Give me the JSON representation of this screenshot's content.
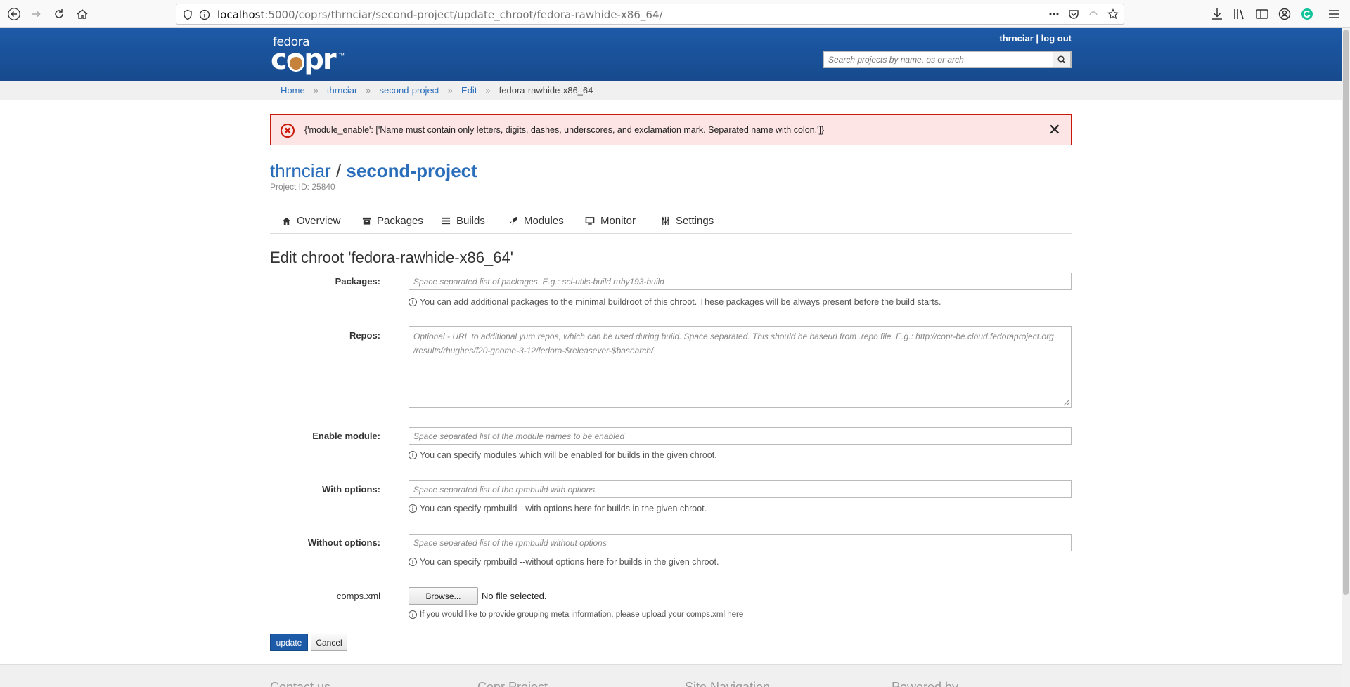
{
  "browser": {
    "url_host": "localhost",
    "url_rest": ":5000/coprs/thrnciar/second-project/update_chroot/fedora-rawhide-x86_64/"
  },
  "header": {
    "logo_top": "fedora",
    "logo_main": "copr",
    "user": "thrnciar",
    "separator": "|",
    "logout": "log out",
    "search_placeholder": "Search projects by name, os or arch"
  },
  "breadcrumb": {
    "items": [
      "Home",
      "thrnciar",
      "second-project",
      "Edit"
    ],
    "current": "fedora-rawhide-x86_64",
    "separator": "»"
  },
  "alert": {
    "message": "{'module_enable': ['Name must contain only letters, digits, dashes, underscores, and exclamation mark. Separated name with colon.']}",
    "close": "✕"
  },
  "project": {
    "owner": "thrnciar",
    "slash": "/",
    "name": "second-project",
    "id_label": "Project ID: 25840"
  },
  "tabs": [
    "Overview",
    "Packages",
    "Builds",
    "Modules",
    "Monitor",
    "Settings"
  ],
  "form": {
    "title": "Edit chroot 'fedora-rawhide-x86_64'",
    "packages_label": "Packages:",
    "packages_placeholder": "Space separated list of packages. E.g.: scl-utils-build ruby193-build",
    "packages_help": "You can add additional packages to the minimal buildroot of this chroot. These packages will be always present before the build starts.",
    "repos_label": "Repos:",
    "repos_placeholder_line1": "Optional - URL to additional yum repos, which can be used during build. Space separated. This should be baseurl from .repo file. E.g.: http://copr-be.cloud.fedoraproject.org",
    "repos_placeholder_line2": "/results/rhughes/f20-gnome-3-12/fedora-$releasever-$basearch/",
    "module_label": "Enable module:",
    "module_placeholder": "Space separated list of the module names to be enabled",
    "module_help": "You can specify modules which will be enabled for builds in the given chroot.",
    "with_label": "With options:",
    "with_placeholder": "Space separated list of the rpmbuild with options",
    "with_help": "You can specify rpmbuild --with options here for builds in the given chroot.",
    "without_label": "Without options:",
    "without_placeholder": "Space separated list of the rpmbuild without options",
    "without_help": "You can specify rpmbuild --without options here for builds in the given chroot.",
    "comps_label": "comps.xml",
    "browse": "Browse...",
    "no_file": "No file selected.",
    "comps_help": "If you would like to provide grouping meta information, please upload your comps.xml here",
    "update": "update",
    "cancel": "Cancel"
  },
  "footer": {
    "cols": [
      "Contact us",
      "Copr Project",
      "Site Navigation",
      "Powered by"
    ]
  },
  "colors": {
    "brand": "#1d5aa7",
    "link": "#2a6ebb",
    "error": "#c9190b"
  }
}
